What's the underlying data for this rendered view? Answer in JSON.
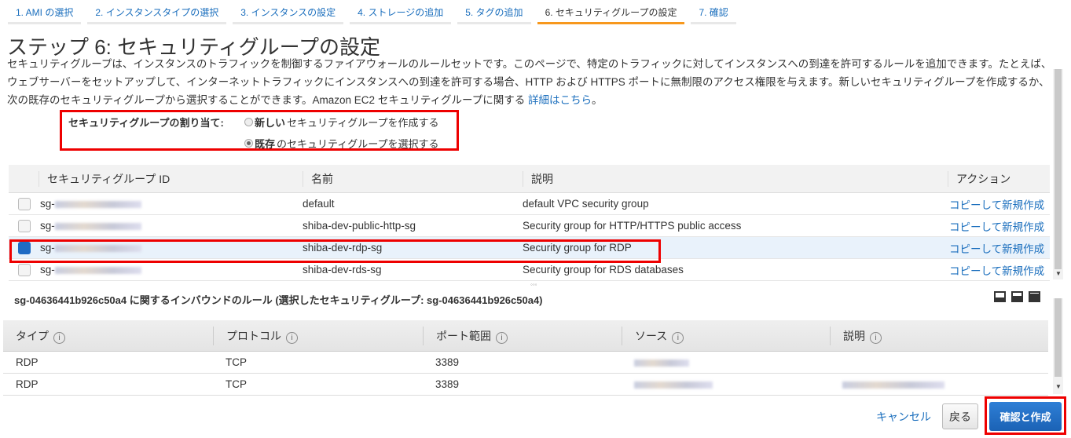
{
  "steps": [
    "1. AMI の選択",
    "2. インスタンスタイプの選択",
    "3. インスタンスの設定",
    "4. ストレージの追加",
    "5. タグの追加",
    "6. セキュリティグループの設定",
    "7. 確認"
  ],
  "title": "ステップ 6: セキュリティグループの設定",
  "description": "セキュリティグループは、インスタンスのトラフィックを制御するファイアウォールのルールセットです。このページで、特定のトラフィックに対してインスタンスへの到達を許可するルールを追加できます。たとえば、ウェブサーバーをセットアップして、インターネットトラフィックにインスタンスへの到達を許可する場合、HTTP および HTTPS ポートに無制限のアクセス権限を与えます。新しいセキュリティグループを作成するか、次の既存のセキュリティグループから選択することができます。Amazon EC2 セキュリティグループに関する ",
  "learn_more": "詳細はこちら",
  "assign": {
    "label": "セキュリティグループの割り当て:",
    "opt1_bold": "新しい",
    "opt1_rest": "セキュリティグループを作成する",
    "opt2_bold": "既存",
    "opt2_rest": "のセキュリティグループを選択する"
  },
  "sg_table": {
    "headers": [
      "セキュリティグループ ID",
      "名前",
      "説明",
      "アクション"
    ],
    "rows": [
      {
        "id": "sg-",
        "name": "default",
        "desc": "default VPC security group",
        "action": "コピーして新規作成"
      },
      {
        "id": "sg-",
        "name": "shiba-dev-public-http-sg",
        "desc": "Security group for HTTP/HTTPS public access",
        "action": "コピーして新規作成"
      },
      {
        "id": "sg-",
        "name": "shiba-dev-rdp-sg",
        "desc": "Security group for RDP",
        "action": "コピーして新規作成"
      },
      {
        "id": "sg-",
        "name": "shiba-dev-rds-sg",
        "desc": "Security group for RDS databases",
        "action": "コピーして新規作成"
      }
    ]
  },
  "rules_title": "sg-04636441b926c50a4 に関するインバウンドのルール (選択したセキュリティグループ: sg-04636441b926c50a4)",
  "rules_table": {
    "headers": [
      "タイプ",
      "プロトコル",
      "ポート範囲",
      "ソース",
      "説明"
    ],
    "rows": [
      {
        "type": "RDP",
        "protocol": "TCP",
        "port": "3389"
      },
      {
        "type": "RDP",
        "protocol": "TCP",
        "port": "3389"
      }
    ]
  },
  "buttons": {
    "cancel": "キャンセル",
    "back": "戻る",
    "confirm": "確認と作成"
  },
  "info_glyph": "i"
}
